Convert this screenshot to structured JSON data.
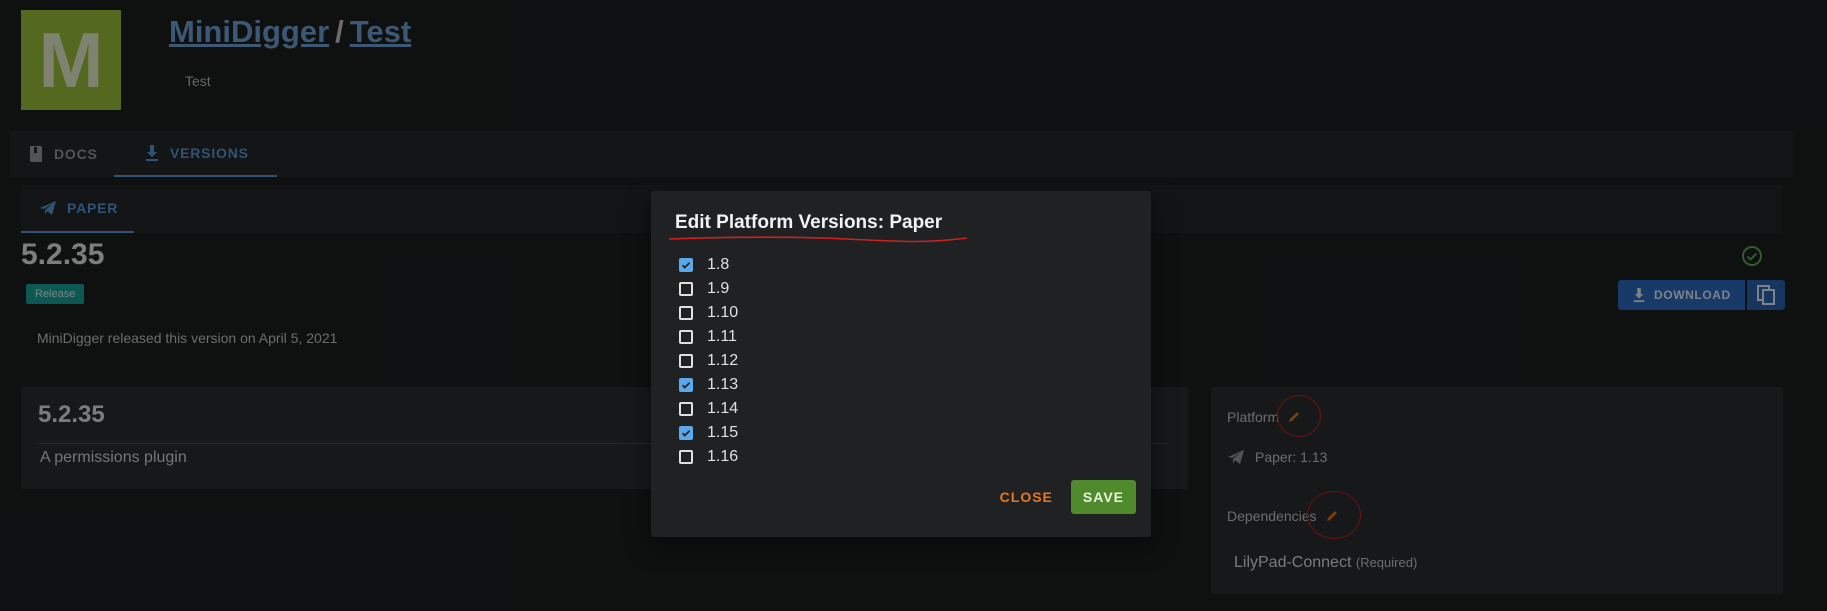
{
  "header": {
    "logo_letter": "M",
    "owner": "MiniDigger",
    "separator": "/",
    "project": "Test",
    "subtitle": "Test"
  },
  "tabs": [
    {
      "label": "DOCS",
      "icon": "book-icon"
    },
    {
      "label": "VERSIONS",
      "icon": "download-icon",
      "active": true
    }
  ],
  "platform_tabs": [
    {
      "label": "PAPER",
      "icon": "paper-plane-icon",
      "active": true
    }
  ],
  "version": {
    "number": "5.2.35",
    "channel": "Release",
    "released_text": "MiniDigger released this version on April 5, 2021",
    "download_label": "DOWNLOAD"
  },
  "card": {
    "title": "5.2.35",
    "description": "A permissions plugin"
  },
  "side": {
    "platform_label": "Platform",
    "platform_value": "Paper: 1.13",
    "dependencies_label": "Dependencies",
    "dependency_name": "LilyPad-Connect",
    "dependency_note": "(Required)"
  },
  "dialog": {
    "title": "Edit Platform Versions: Paper",
    "options": [
      {
        "label": "1.8",
        "checked": true
      },
      {
        "label": "1.9",
        "checked": false
      },
      {
        "label": "1.10",
        "checked": false
      },
      {
        "label": "1.11",
        "checked": false
      },
      {
        "label": "1.12",
        "checked": false
      },
      {
        "label": "1.13",
        "checked": true
      },
      {
        "label": "1.14",
        "checked": false
      },
      {
        "label": "1.15",
        "checked": true
      },
      {
        "label": "1.16",
        "checked": false
      }
    ],
    "close_label": "CLOSE",
    "save_label": "SAVE"
  },
  "colors": {
    "accent": "#5a9ad8",
    "checkbox": "#5aa8ec",
    "save": "#4f8a2c",
    "close": "#e6771e",
    "annotation": "#cc2222"
  }
}
